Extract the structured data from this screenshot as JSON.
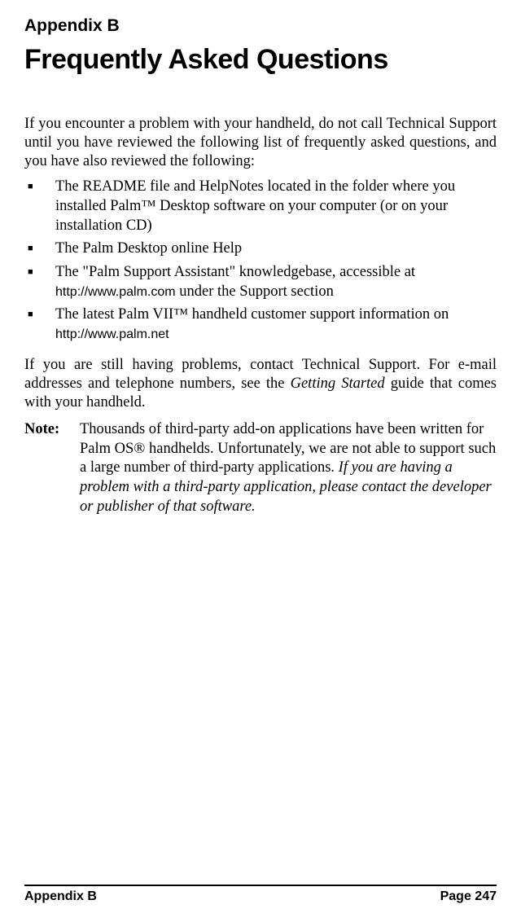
{
  "header": {
    "appendix_label": "Appendix B",
    "title": "Frequently Asked Questions"
  },
  "intro": "If you encounter a problem with your handheld, do not call Technical Support until you have reviewed the following list of frequently asked questions, and you have also reviewed the following:",
  "bullets": [
    {
      "text_a": "The README file and HelpNotes located in the folder where you installed Palm™ Desktop software on your computer (or on your installation CD)"
    },
    {
      "text_a": "The Palm Desktop online Help"
    },
    {
      "text_a": "The \"Palm Support Assistant\" knowledgebase, accessible at ",
      "url": "http://www.palm.com",
      "text_b": " under the Support section"
    },
    {
      "text_a": "The latest Palm VII™ handheld customer support information on ",
      "url": "http://www.palm.net"
    }
  ],
  "paragraph2": {
    "pre": "If you are still having problems, contact Technical Support. For e-mail addresses and telephone numbers, see the ",
    "italic": "Getting Started",
    "post": " guide that comes with your handheld."
  },
  "note": {
    "label": "Note:",
    "body_a": "Thousands of third-party add-on applications have been written for Palm OS® handhelds. Unfortunately, we are not able to support such a large number of third-party applications. ",
    "body_italic": "If you are having a problem with a third-party application, please contact the developer or publisher of that software."
  },
  "footer": {
    "left": "Appendix B",
    "right": "Page 247"
  }
}
